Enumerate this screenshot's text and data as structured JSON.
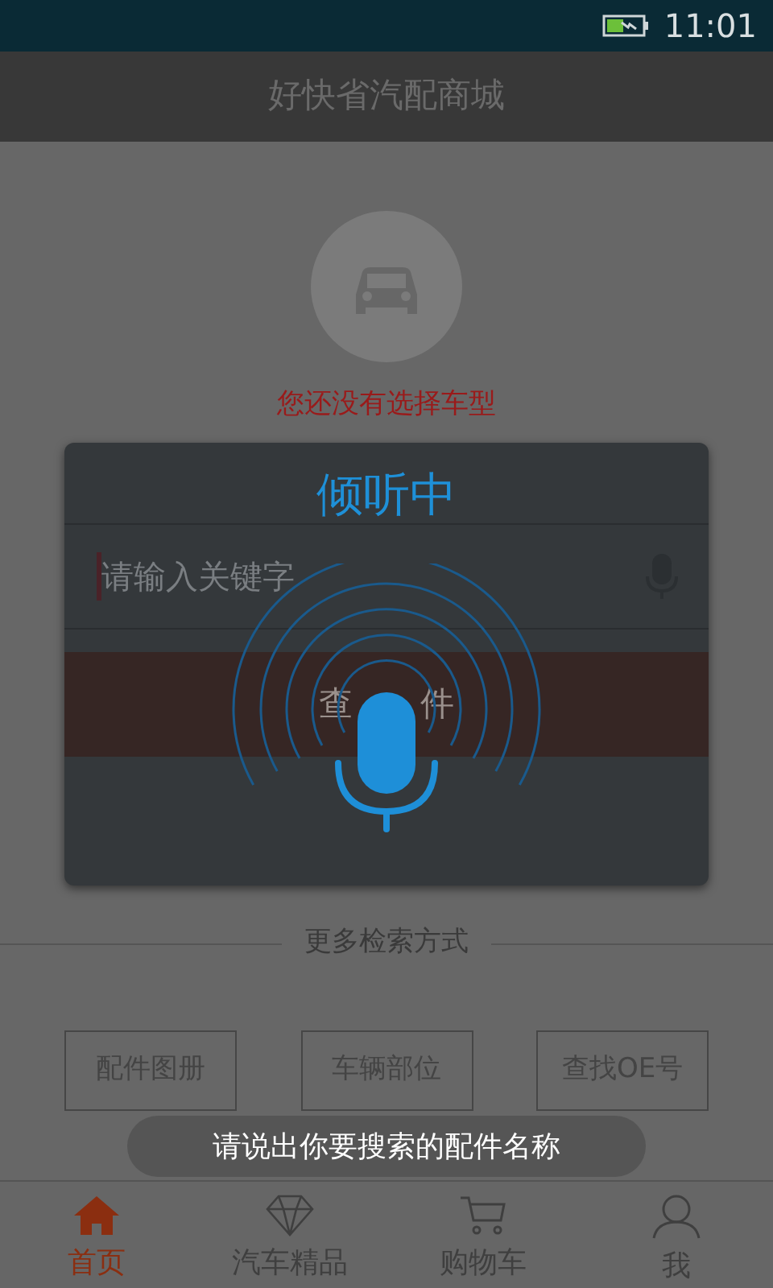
{
  "status_bar": {
    "time": "11:01"
  },
  "title": "好快省汽配商城",
  "car_prompt": "您还没有选择车型",
  "search": {
    "placeholder": "请输入关键字",
    "button_visible_parts": [
      "查",
      "件"
    ]
  },
  "voice_dialog": {
    "title": "倾听中"
  },
  "more_search": {
    "heading": "更多检索方式",
    "buttons": [
      "配件图册",
      "车辆部位",
      "查找OE号"
    ]
  },
  "toast": "请说出你要搜索的配件名称",
  "tab_bar": [
    {
      "label": "首页",
      "kind": "home",
      "selected": true
    },
    {
      "label": "汽车精品",
      "kind": "diamond",
      "selected": false
    },
    {
      "label": "购物车",
      "kind": "cart",
      "selected": false
    },
    {
      "label": "我",
      "kind": "person",
      "selected": false
    }
  ]
}
